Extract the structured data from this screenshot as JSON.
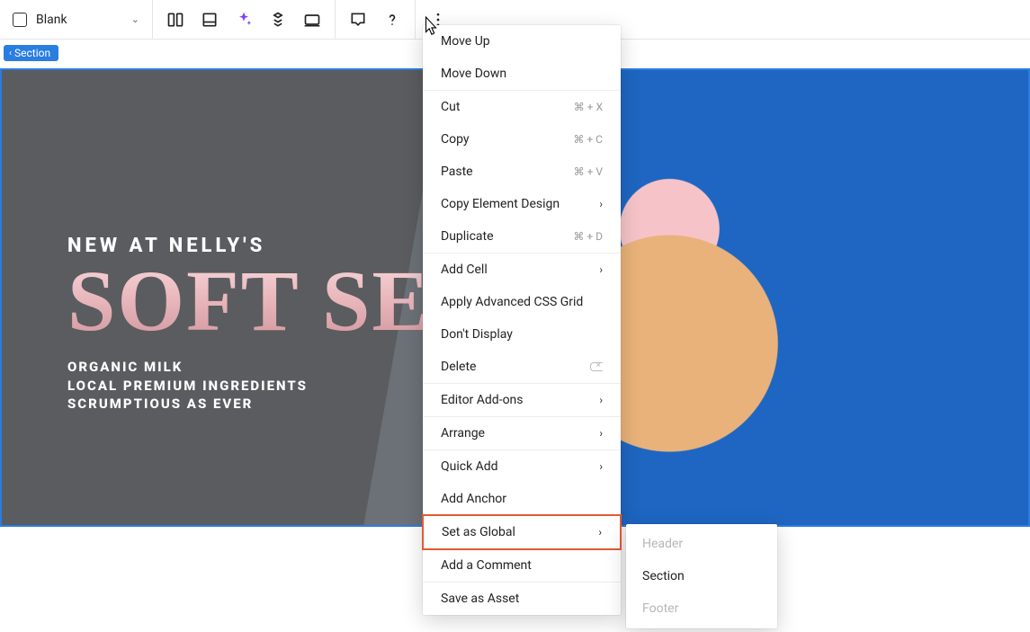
{
  "toolbar": {
    "layout_label": "Blank"
  },
  "section_chip": "Section",
  "hero": {
    "eyebrow": "NEW AT NELLY'S",
    "headline": "Soft Serve",
    "lines": {
      "l1": "ORGANIC MILK",
      "l2": "LOCAL PREMIUM INGREDIENTS",
      "l3": "SCRUMPTIOUS AS EVER"
    }
  },
  "menu": {
    "move_up": "Move Up",
    "move_down": "Move Down",
    "cut": "Cut",
    "cut_sc": "⌘ + X",
    "copy": "Copy",
    "copy_sc": "⌘ + C",
    "paste": "Paste",
    "paste_sc": "⌘ + V",
    "copy_design": "Copy Element Design",
    "duplicate": "Duplicate",
    "duplicate_sc": "⌘ + D",
    "add_cell": "Add Cell",
    "apply_css_grid": "Apply Advanced CSS Grid",
    "dont_display": "Don't Display",
    "delete": "Delete",
    "editor_addons": "Editor Add-ons",
    "arrange": "Arrange",
    "quick_add": "Quick Add",
    "add_anchor": "Add Anchor",
    "set_as_global": "Set as Global",
    "add_comment": "Add a Comment",
    "save_as_asset": "Save as Asset"
  },
  "submenu": {
    "header": "Header",
    "section": "Section",
    "footer": "Footer"
  }
}
